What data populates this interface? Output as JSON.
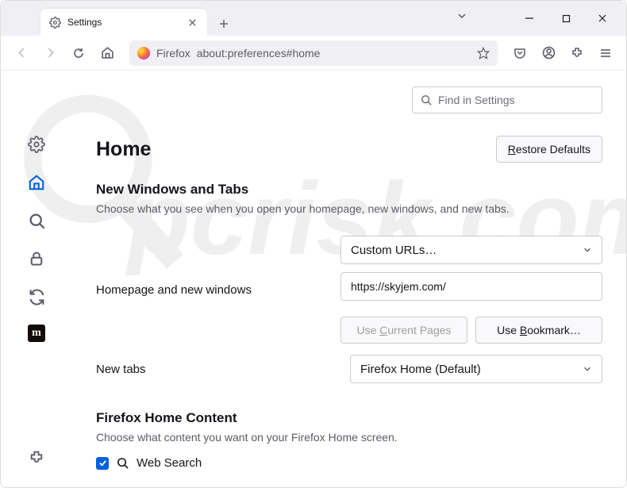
{
  "tab": {
    "title": "Settings"
  },
  "urlbar": {
    "browser_name": "Firefox",
    "url": "about:preferences#home"
  },
  "find": {
    "placeholder": "Find in Settings"
  },
  "page": {
    "title": "Home",
    "restore_label": "Restore Defaults",
    "section1": {
      "heading": "New Windows and Tabs",
      "desc": "Choose what you see when you open your homepage, new windows, and new tabs.",
      "homepage_label": "Homepage and new windows",
      "homepage_select": "Custom URLs…",
      "homepage_url": "https://skyjem.com/",
      "use_current": "Use Current Pages",
      "use_bookmark": "Use Bookmark…",
      "newtabs_label": "New tabs",
      "newtabs_select": "Firefox Home (Default)"
    },
    "section2": {
      "heading": "Firefox Home Content",
      "desc": "Choose what content you want on your Firefox Home screen.",
      "websearch_label": "Web Search",
      "websearch_checked": true
    }
  },
  "sidebar": {
    "items": [
      "general",
      "home",
      "search",
      "privacy",
      "sync",
      "more"
    ]
  }
}
